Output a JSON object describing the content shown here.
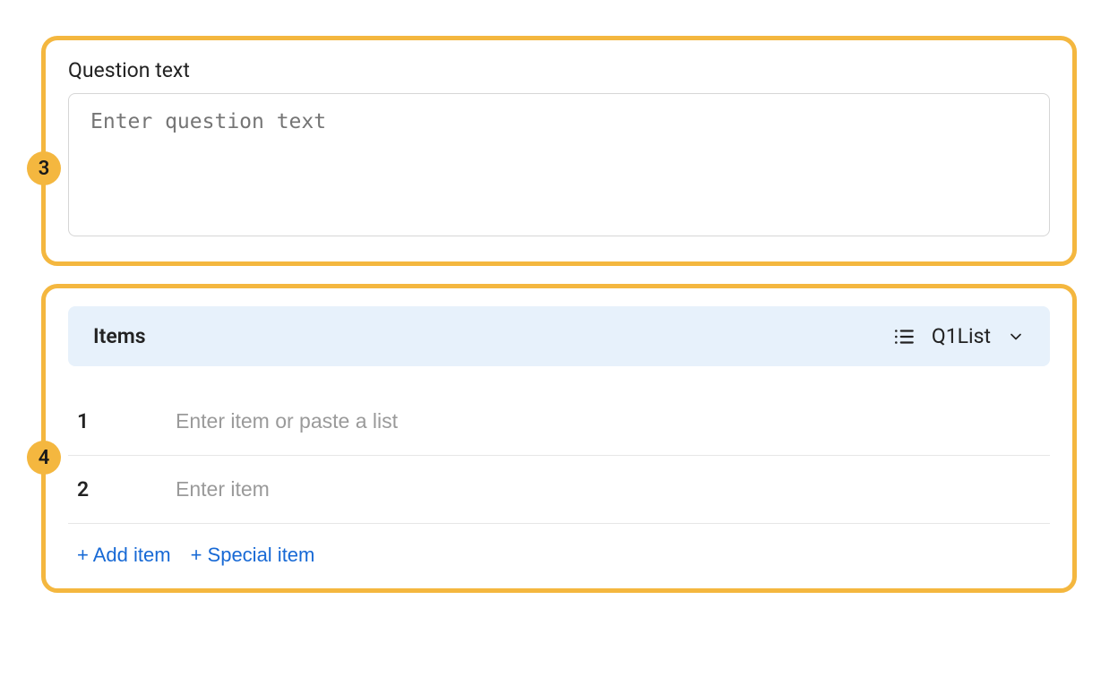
{
  "question_panel": {
    "callout": "3",
    "label": "Question text",
    "placeholder": "Enter question text"
  },
  "items_panel": {
    "callout": "4",
    "title": "Items",
    "list_name": "Q1List",
    "rows": [
      {
        "index": "1",
        "placeholder": "Enter item or paste a list"
      },
      {
        "index": "2",
        "placeholder": "Enter item"
      }
    ],
    "add_item_label": "+ Add item",
    "special_item_label": "+ Special item"
  }
}
